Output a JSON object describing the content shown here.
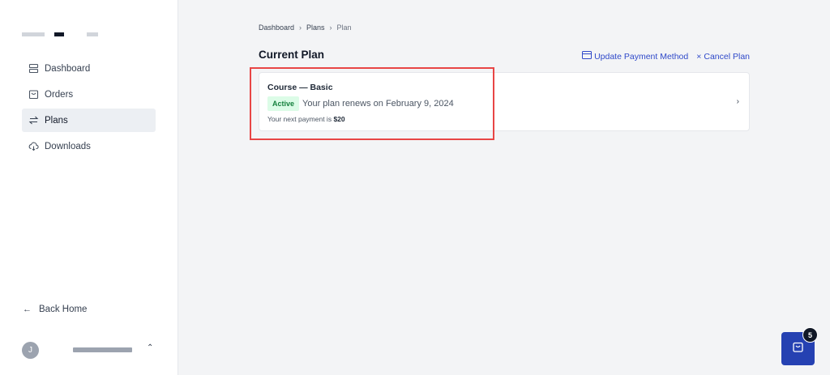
{
  "sidebar": {
    "items": [
      {
        "label": "Dashboard",
        "icon": "server-icon",
        "active": false
      },
      {
        "label": "Orders",
        "icon": "shopping-bag-icon",
        "active": false
      },
      {
        "label": "Plans",
        "icon": "arrows-exchange-icon",
        "active": true
      },
      {
        "label": "Downloads",
        "icon": "cloud-download-icon",
        "active": false
      }
    ],
    "back_home": "Back Home",
    "user": {
      "initial": "J"
    }
  },
  "breadcrumb": [
    "Dashboard",
    "Plans",
    "Plan"
  ],
  "page_title": "Current Plan",
  "actions": {
    "update_payment": "Update Payment Method",
    "cancel_plan": "Cancel Plan"
  },
  "plan": {
    "name": "Course — Basic",
    "status": "Active",
    "renews": "Your plan renews on February 9, 2024",
    "next_payment_prefix": "Your next payment is",
    "next_payment_amount": "$20"
  },
  "cart": {
    "count": "5"
  },
  "colors": {
    "accent": "#2f49c9",
    "cart_button": "#2541b2",
    "active_badge_bg": "#dcfce7",
    "active_badge_text": "#15803d",
    "highlight": "#e84545"
  }
}
